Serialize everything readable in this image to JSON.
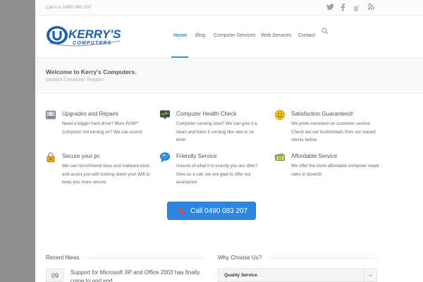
{
  "topbar": {
    "call_us": "Call Us: 0490 083 207",
    "social": [
      "twitter-icon",
      "facebook-icon",
      "google-plus-icon",
      "rss-icon"
    ]
  },
  "logo": {
    "brand": "KERRY'S",
    "sub": "COMPUTERS"
  },
  "nav": {
    "items": [
      {
        "label": "Home",
        "active": true
      },
      {
        "label": "Blog"
      },
      {
        "label": "Computer Services"
      },
      {
        "label": "Web Services"
      },
      {
        "label": "Contact"
      }
    ]
  },
  "welcome": {
    "title": "Welcome to Kerry's Computers.",
    "subtitle": "Ipswich Computer Repairs"
  },
  "features": [
    {
      "icon": "hard-drive-icon",
      "title": "Upgrades and Repairs",
      "text": "Need a bigger hard drive? More RAM? Computer not turning on? We can assist!"
    },
    {
      "icon": "monitor-icon",
      "title": "Computer Health Check",
      "text": "Computer running slow? We can give it a clean and have it running like new in no time!"
    },
    {
      "icon": "smiley-icon",
      "title": "Satisfaction Guaranteed!",
      "text": "We pride ourselves on customer service. Check out our testimonials from our valued clients below."
    },
    {
      "icon": "lock-icon",
      "title": "Secure your pc",
      "text": "We can recommend virus and malware tools and assist you with locking down your Wifi to keep you more secure."
    },
    {
      "icon": "chat-bubble-icon",
      "title": "Friendly Service",
      "text": "Unsure of what it is exactly you are after? Give us a call, we are glad to offer our assistance"
    },
    {
      "icon": "money-icon",
      "title": "Affordable Service",
      "text": "We offer the most affordable computer repair rates in Ipswich."
    }
  ],
  "cta": {
    "label": "Call 0490 083 207"
  },
  "recent_news": {
    "title": "Recent News",
    "items": [
      {
        "day": "09",
        "title": "Support for Microsoft XP and Office 2003 has finally come to and end"
      }
    ]
  },
  "why_choose": {
    "title": "Why Choose Us?",
    "items": [
      {
        "label": "Quality Service",
        "toggle": "–"
      }
    ]
  },
  "colors": {
    "accent": "#3a8fd2",
    "cta": "#2f86e0",
    "background": "#8f8f8f"
  }
}
